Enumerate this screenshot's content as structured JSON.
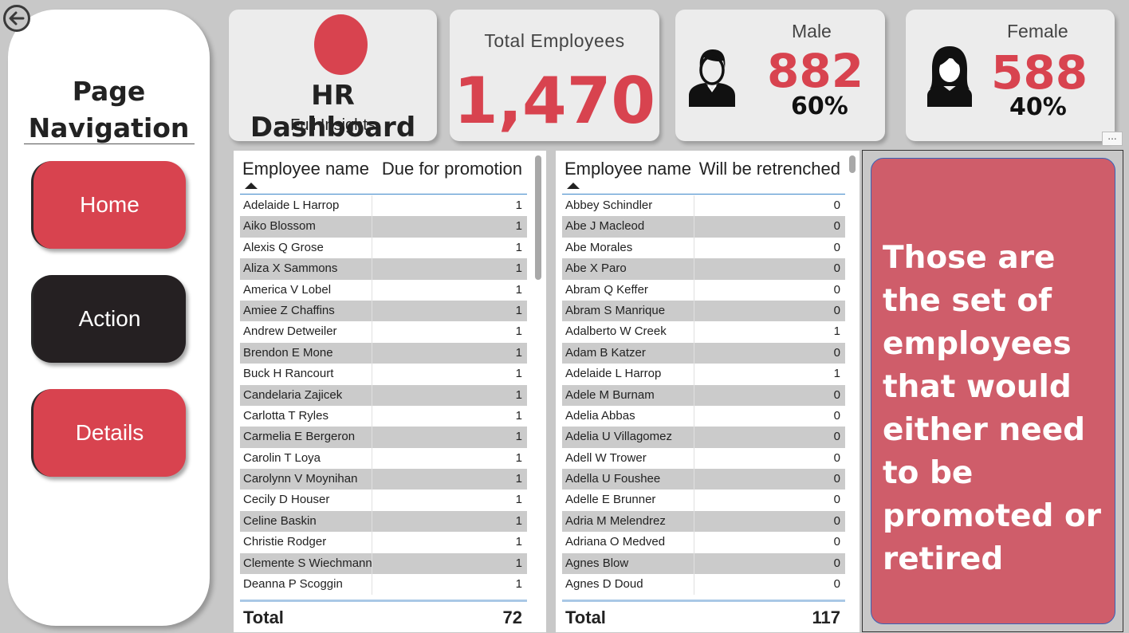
{
  "navigation": {
    "title_line1": "Page",
    "title_line2": "Navigation",
    "buttons": [
      {
        "label": "Home"
      },
      {
        "label": "Action"
      },
      {
        "label": "Details"
      }
    ]
  },
  "cards": {
    "hr": {
      "title": "HR Dashboard",
      "subtitle": "Full Insights"
    },
    "total": {
      "label": "Total Employees",
      "value": "1,470"
    },
    "male": {
      "label": "Male",
      "value": "882",
      "percent": "60%"
    },
    "female": {
      "label": "Female",
      "value": "588",
      "percent": "40%"
    }
  },
  "promotion_table": {
    "columns": [
      "Employee name",
      "Due for promotion"
    ],
    "rows": [
      {
        "name": "Adelaide L Harrop",
        "value": "1"
      },
      {
        "name": "Aiko Blossom",
        "value": "1"
      },
      {
        "name": "Alexis Q Grose",
        "value": "1"
      },
      {
        "name": "Aliza X Sammons",
        "value": "1"
      },
      {
        "name": "America V Lobel",
        "value": "1"
      },
      {
        "name": "Amiee Z Chaffins",
        "value": "1"
      },
      {
        "name": "Andrew Detweiler",
        "value": "1"
      },
      {
        "name": "Brendon E Mone",
        "value": "1"
      },
      {
        "name": "Buck H Rancourt",
        "value": "1"
      },
      {
        "name": "Candelaria Zajicek",
        "value": "1"
      },
      {
        "name": "Carlotta T Ryles",
        "value": "1"
      },
      {
        "name": "Carmelia E Bergeron",
        "value": "1"
      },
      {
        "name": "Carolin T Loya",
        "value": "1"
      },
      {
        "name": "Carolynn V Moynihan",
        "value": "1"
      },
      {
        "name": "Cecily D Houser",
        "value": "1"
      },
      {
        "name": "Celine Baskin",
        "value": "1"
      },
      {
        "name": "Christie Rodger",
        "value": "1"
      },
      {
        "name": "Clemente S Wiechmann",
        "value": "1"
      },
      {
        "name": "Deanna P Scoggin",
        "value": "1"
      }
    ],
    "total_label": "Total",
    "total_value": "72"
  },
  "retrench_table": {
    "columns": [
      "Employee name",
      "Will be retrenched"
    ],
    "rows": [
      {
        "name": "Abbey Schindler",
        "value": "0"
      },
      {
        "name": "Abe J Macleod",
        "value": "0"
      },
      {
        "name": "Abe Morales",
        "value": "0"
      },
      {
        "name": "Abe X Paro",
        "value": "0"
      },
      {
        "name": "Abram Q Keffer",
        "value": "0"
      },
      {
        "name": "Abram S Manrique",
        "value": "0"
      },
      {
        "name": "Adalberto W Creek",
        "value": "1"
      },
      {
        "name": "Adam B Katzer",
        "value": "0"
      },
      {
        "name": "Adelaide L Harrop",
        "value": "1"
      },
      {
        "name": "Adele M Burnam",
        "value": "0"
      },
      {
        "name": "Adelia Abbas",
        "value": "0"
      },
      {
        "name": "Adelia U Villagomez",
        "value": "0"
      },
      {
        "name": "Adell W Trower",
        "value": "0"
      },
      {
        "name": "Adella U Foushee",
        "value": "0"
      },
      {
        "name": "Adelle E Brunner",
        "value": "0"
      },
      {
        "name": "Adria M Melendrez",
        "value": "0"
      },
      {
        "name": "Adriana O Medved",
        "value": "0"
      },
      {
        "name": "Agnes Blow",
        "value": "0"
      },
      {
        "name": "Agnes D Doud",
        "value": "0"
      }
    ],
    "total_label": "Total",
    "total_value": "117"
  },
  "info_box": {
    "text": "Those are the set of employees that would either need to be promoted or retired"
  },
  "more_options": "...",
  "colors": {
    "accent": "#d8434f",
    "dark": "#252022",
    "panel": "#ececec",
    "info_bg": "#cf5d6a"
  }
}
